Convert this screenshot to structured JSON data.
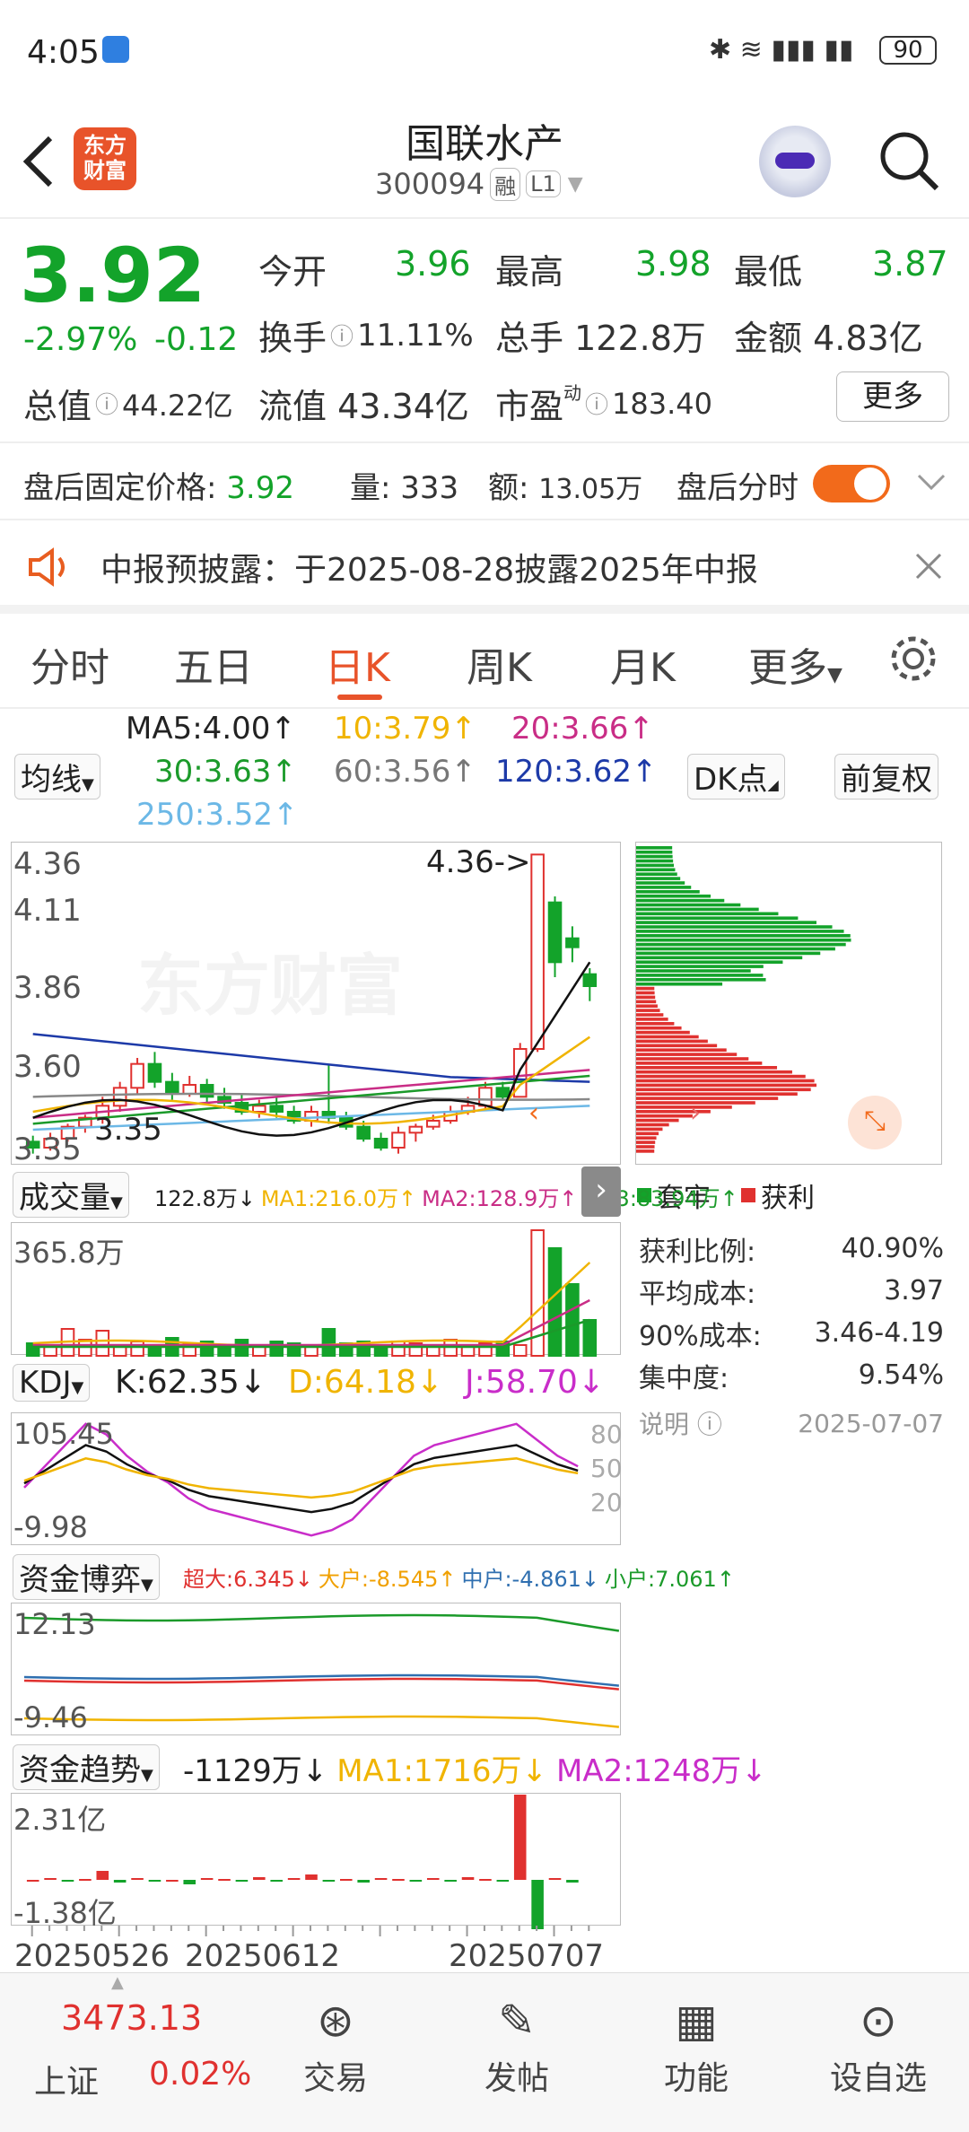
{
  "status": {
    "time": "4:05",
    "battery": "90"
  },
  "header": {
    "logo": "东方\n财富",
    "title": "国联水产",
    "code": "300094",
    "tag_rong": "融",
    "tag_l1": "L1"
  },
  "quote": {
    "price": "3.92",
    "change_pct": "-2.97%",
    "change": "-0.12",
    "open_label": "今开",
    "open": "3.96",
    "high_label": "最高",
    "high": "3.98",
    "low_label": "最低",
    "low": "3.87",
    "turnover_label": "换手",
    "turnover": "11.11%",
    "vol_label": "总手",
    "vol": "122.8万",
    "amount_label": "金额",
    "amount": "4.83亿",
    "mcap_label": "总值",
    "mcap": "44.22亿",
    "float_label": "流值",
    "float": "43.34亿",
    "pe_label": "市盈",
    "pe_sup": "动",
    "pe": "183.40",
    "more": "更多"
  },
  "after": {
    "price_label": "盘后固定价格:",
    "price": "3.92",
    "vol_label": "量:",
    "vol": "333",
    "amt_label": "额:",
    "amt": "13.05万",
    "toggle_label": "盘后分时"
  },
  "notice": {
    "text": "中报预披露：于2025-08-28披露2025年中报"
  },
  "tabs": [
    "分时",
    "五日",
    "日K",
    "周K",
    "月K",
    "更多"
  ],
  "ma": {
    "dropdown": "均线",
    "ma5": "MA5:4.00↑",
    "ma10": "10:3.79↑",
    "ma20": "20:3.66↑",
    "ma30": "30:3.63↑",
    "ma60": "60:3.56↑",
    "ma120": "120:3.62↑",
    "ma250": "250:3.52↑",
    "dk": "DK点",
    "fq": "前复权"
  },
  "colors": {
    "up": "#e0312f",
    "down": "#13a32a",
    "ma5": "#111111",
    "ma10": "#f0b400",
    "ma20": "#c92d86",
    "ma30": "#1b9a2a",
    "ma60": "#888888",
    "ma120": "#1d3aa8",
    "ma250": "#6cb8e6"
  },
  "kchart": {
    "y_labels": [
      "4.36",
      "4.11",
      "3.86",
      "3.60",
      "3.35"
    ],
    "high_ann": "4.36->",
    "low_ann": "3.35"
  },
  "chip": {
    "legend_trap": "套牢",
    "legend_profit": "获利",
    "stats": [
      {
        "k": "获利比例:",
        "v": "40.90%"
      },
      {
        "k": "平均成本:",
        "v": "3.97"
      },
      {
        "k": "90%成本:",
        "v": "3.46-4.19"
      },
      {
        "k": "集中度:",
        "v": "9.54%"
      }
    ],
    "note": "说明",
    "date": "2025-07-07"
  },
  "volume": {
    "dropdown": "成交量",
    "vol": "122.8万↓",
    "ma1": "MA1:216.0万↑",
    "ma2": "MA2:128.9万↑",
    "ma3": "MA3:83.94万↑",
    "ymax": "365.8万"
  },
  "kdj": {
    "dropdown": "KDJ",
    "k": "K:62.35↓",
    "d": "D:64.18↓",
    "j": "J:58.70↓",
    "ymax": "105.45",
    "ymin": "-9.98",
    "levels": [
      "80",
      "50",
      "20"
    ]
  },
  "fund": {
    "dropdown": "资金博弈",
    "big": "超大:6.345↓",
    "large": "大户:-8.545↑",
    "mid": "中户:-4.861↓",
    "small": "小户:7.061↑",
    "ymax": "12.13",
    "ymin": "-9.46"
  },
  "trend": {
    "dropdown": "资金趋势",
    "val": "-1129万↓",
    "ma1": "MA1:1716万↓",
    "ma2": "MA2:1248万↓",
    "ymax": "2.31亿",
    "ymin": "-1.38亿"
  },
  "dates": [
    "20250526",
    "20250612",
    "20250707"
  ],
  "bottom": {
    "index_val": "3473.13",
    "index_name": "上证",
    "index_pct": "0.02%",
    "trade": "交易",
    "post": "发帖",
    "func": "功能",
    "watch": "设自选"
  }
}
